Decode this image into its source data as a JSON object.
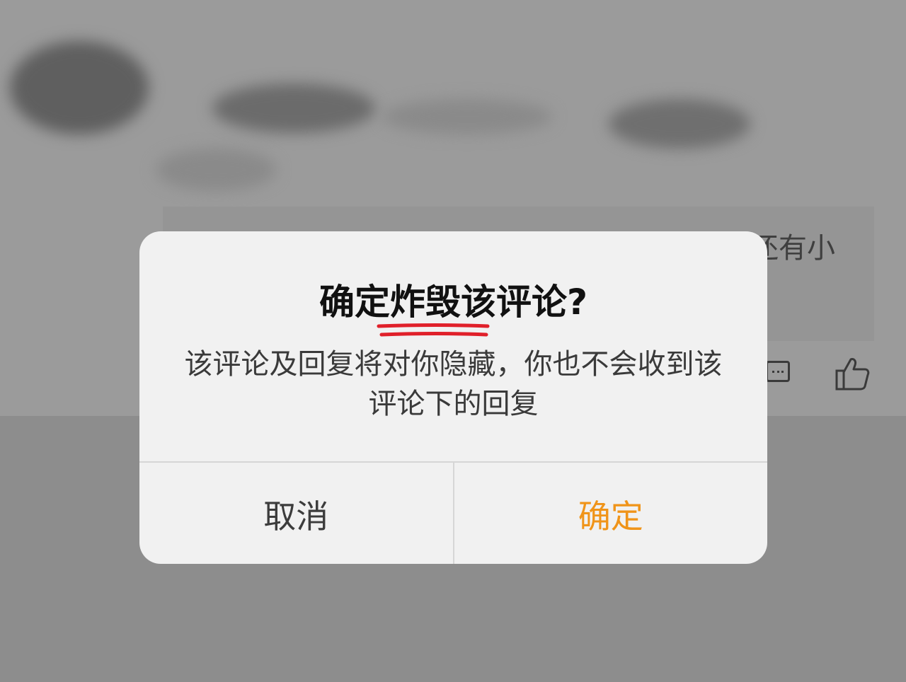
{
  "background": {
    "reply_snippet": "还有小",
    "icons": [
      "comment-icon",
      "like-icon"
    ]
  },
  "dialog": {
    "title": "确定炸毁该评论?",
    "message": "该评论及回复将对你隐藏，你也不会收到该评论下的回复",
    "cancel_label": "取消",
    "confirm_label": "确定"
  },
  "colors": {
    "confirm": "#f09419",
    "underline_annotation": "#e0202a"
  }
}
